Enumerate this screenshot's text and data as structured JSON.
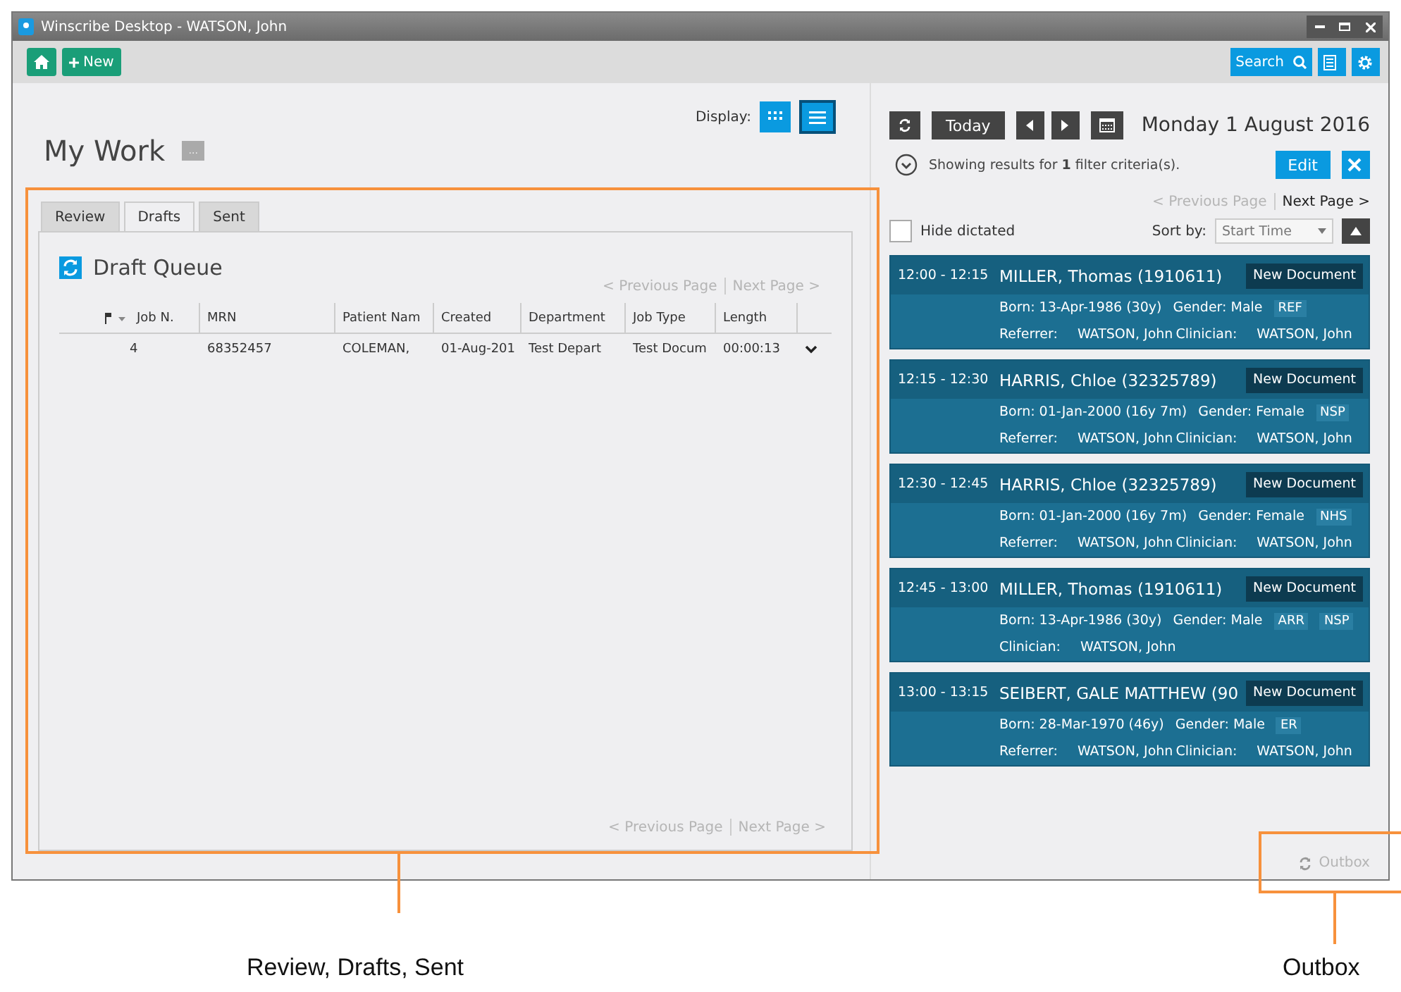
{
  "window": {
    "title": "Winscribe Desktop - WATSON, John",
    "controls": [
      {
        "kind": "minimize"
      },
      {
        "kind": "maximize"
      },
      {
        "kind": "close"
      }
    ]
  },
  "toolbar": {
    "new_label": "New",
    "search_label": "Search"
  },
  "my_work": {
    "title": "My Work",
    "menu_label": "...",
    "display_label": "Display:",
    "display_modes": [
      {
        "kind": "grid",
        "selected": false
      },
      {
        "kind": "list",
        "selected": true
      }
    ],
    "tabs": [
      {
        "label": "Review",
        "selected": false
      },
      {
        "label": "Drafts",
        "selected": true
      },
      {
        "label": "Sent",
        "selected": false
      }
    ],
    "queue": {
      "title": "Draft Queue",
      "prev_top": {
        "label": "< Previous Page",
        "disabled": true
      },
      "next_top": {
        "label": "Next Page >",
        "disabled": true
      },
      "columns": [
        "Job N.",
        "MRN",
        "Patient Nam",
        "Created",
        "Department",
        "Job Type",
        "Length"
      ],
      "rows": [
        {
          "cells": [
            "4",
            "68352457",
            "COLEMAN,",
            "01-Aug-201",
            "Test Depart",
            "Test Docum",
            "00:00:13"
          ]
        }
      ],
      "prev_bottom": {
        "label": "< Previous Page",
        "disabled": true
      },
      "next_bottom": {
        "label": "Next Page >",
        "disabled": true
      }
    }
  },
  "schedule": {
    "today_label": "Today",
    "date": "Monday 1 August 2016",
    "filter_text": "Showing results for **1** filter criteria(s).",
    "edit_label": "Edit",
    "prev_page": {
      "label": "< Previous Page",
      "disabled": true
    },
    "next_page": {
      "label": "Next Page >",
      "disabled": false
    },
    "hide_dictated": {
      "label": "Hide dictated",
      "checked": false
    },
    "sort_label": "Sort by:",
    "sort_value": "Start Time",
    "appointments": [
      {
        "time": "12:00 - 12:15",
        "patient": "MILLER, Thomas  (1910611)",
        "action": "New Document",
        "born": "Born: 13-Apr-1986  (30y)",
        "gender": "Gender: Male",
        "tags": [
          "REF"
        ],
        "people": [
          {
            "label": "Referrer:",
            "value": "WATSON, John"
          },
          {
            "label": "Clinician:",
            "value": "WATSON, John"
          }
        ]
      },
      {
        "time": "12:15 - 12:30",
        "patient": "HARRIS, Chloe  (32325789)",
        "action": "New Document",
        "born": "Born: 01-Jan-2000  (16y 7m)",
        "gender": "Gender: Female",
        "tags": [
          "NSP"
        ],
        "people": [
          {
            "label": "Referrer:",
            "value": "WATSON, John"
          },
          {
            "label": "Clinician:",
            "value": "WATSON, John"
          }
        ]
      },
      {
        "time": "12:30 - 12:45",
        "patient": "HARRIS, Chloe  (32325789)",
        "action": "New Document",
        "born": "Born: 01-Jan-2000  (16y 7m)",
        "gender": "Gender: Female",
        "tags": [
          "NHS"
        ],
        "people": [
          {
            "label": "Referrer:",
            "value": "WATSON, John"
          },
          {
            "label": "Clinician:",
            "value": "WATSON, John"
          }
        ]
      },
      {
        "time": "12:45 - 13:00",
        "patient": "MILLER, Thomas  (1910611)",
        "action": "New Document",
        "born": "Born: 13-Apr-1986  (30y)",
        "gender": "Gender: Male",
        "tags": [
          "ARR",
          "NSP"
        ],
        "people": [
          {
            "label": "Clinician:",
            "value": "WATSON, John"
          }
        ]
      },
      {
        "time": "13:00 - 13:15",
        "patient": "SEIBERT, GALE MATTHEW  (90",
        "action": "New Document",
        "born": "Born: 28-Mar-1970  (46y)",
        "gender": "Gender: Male",
        "tags": [
          "ER"
        ],
        "people": [
          {
            "label": "Referrer:",
            "value": "WATSON, John"
          },
          {
            "label": "Clinician:",
            "value": "WATSON, John"
          }
        ]
      }
    ]
  },
  "status_bar": {
    "outbox_label": "Outbox"
  },
  "annotations": [
    {
      "label": "Review, Drafts, Sent"
    },
    {
      "label": "Outbox"
    }
  ]
}
